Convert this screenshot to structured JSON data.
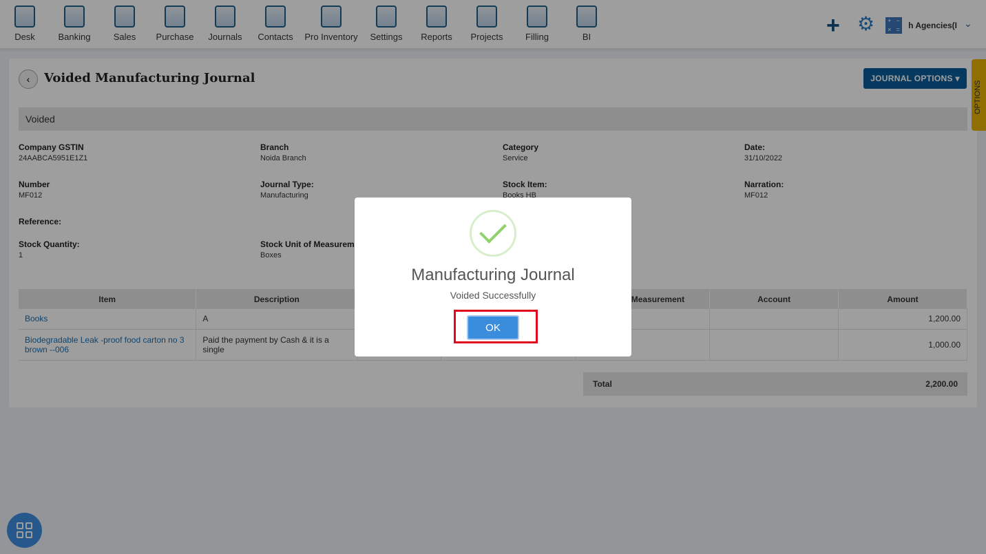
{
  "nav": [
    {
      "label": "Desk",
      "icon": "desk-icon"
    },
    {
      "label": "Banking",
      "icon": "bank-icon"
    },
    {
      "label": "Sales",
      "icon": "sales-icon"
    },
    {
      "label": "Purchase",
      "icon": "purchase-icon"
    },
    {
      "label": "Journals",
      "icon": "journals-icon"
    },
    {
      "label": "Contacts",
      "icon": "contacts-icon"
    },
    {
      "label": "Pro Inventory",
      "icon": "inventory-icon"
    },
    {
      "label": "Settings",
      "icon": "settings-icon"
    },
    {
      "label": "Reports",
      "icon": "reports-icon"
    },
    {
      "label": "Projects",
      "icon": "projects-icon"
    },
    {
      "label": "Filling",
      "icon": "filling-icon"
    },
    {
      "label": "BI",
      "icon": "bi-icon"
    }
  ],
  "header": {
    "company": "sh Agencies(I",
    "plus": "+",
    "gear": "⚙",
    "chevron": "⌄"
  },
  "page": {
    "back": "‹",
    "title": "Voided Manufacturing Journal",
    "options_button": "JOURNAL OPTIONS ▾",
    "status": "Voided",
    "side_tab": "OPTIONS"
  },
  "fields": [
    {
      "label": "Company GSTIN",
      "value": "24AABCA5951E1Z1"
    },
    {
      "label": "Branch",
      "value": "Noida Branch"
    },
    {
      "label": "Category",
      "value": "Service"
    },
    {
      "label": "Date:",
      "value": "31/10/2022"
    },
    {
      "label": "Number",
      "value": "MF012"
    },
    {
      "label": "Journal Type:",
      "value": "Manufacturing"
    },
    {
      "label": "Stock Item:",
      "value": "Books HB"
    },
    {
      "label": "Narration:",
      "value": "MF012"
    },
    {
      "label": "Reference:",
      "value": ""
    },
    {
      "label": "Stock Quantity:",
      "value": "1"
    },
    {
      "label": "Stock Unit of Measurem",
      "value": "Boxes"
    }
  ],
  "table": {
    "headers": [
      "Item",
      "Description",
      "",
      "",
      "Measurement",
      "Account",
      "Amount"
    ],
    "rows": [
      [
        "Books",
        "A",
        "",
        "",
        "",
        "",
        "1,200.00"
      ],
      [
        "Biodegradable Leak -proof food carton no 3 brown --006",
        "Paid the payment by Cash & it is a single",
        "",
        "",
        "",
        "",
        "1,000.00"
      ]
    ],
    "total_label": "Total",
    "total_value": "2,200.00"
  },
  "modal": {
    "title": "Manufacturing Journal",
    "message": "Voided Successfully",
    "ok": "OK",
    "success_color": "#8fd16a"
  }
}
